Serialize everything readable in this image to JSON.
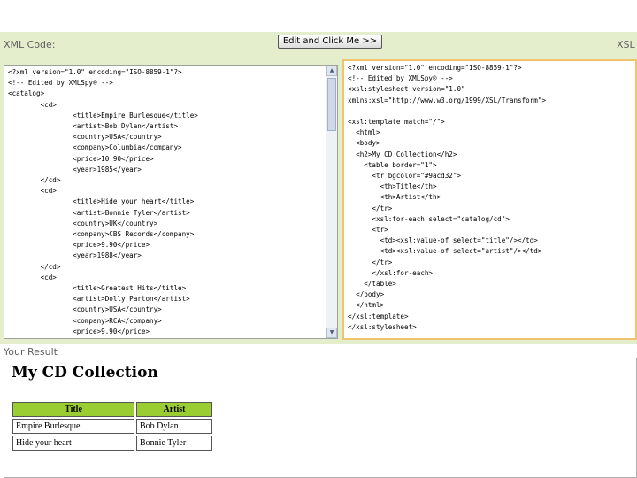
{
  "labels": {
    "xml_code": "XML Code:",
    "xsl_code": "XSL",
    "your_result": "Your Result"
  },
  "run_button": "Edit and Click Me >>",
  "xml_lines": [
    "<?xml version=\"1.0\" encoding=\"ISO-8859-1\"?>",
    "<!-- Edited by XMLSpy® -->",
    "<catalog>",
    "        <cd>",
    "                <title>Empire Burlesque</title>",
    "                <artist>Bob Dylan</artist>",
    "                <country>USA</country>",
    "                <company>Columbia</company>",
    "                <price>10.90</price>",
    "                <year>1985</year>",
    "        </cd>",
    "        <cd>",
    "                <title>Hide your heart</title>",
    "                <artist>Bonnie Tyler</artist>",
    "                <country>UK</country>",
    "                <company>CBS Records</company>",
    "                <price>9.90</price>",
    "                <year>1988</year>",
    "        </cd>",
    "        <cd>",
    "                <title>Greatest Hits</title>",
    "                <artist>Dolly Parton</artist>",
    "                <country>USA</country>",
    "                <company>RCA</company>",
    "                <price>9.90</price>"
  ],
  "xsl_lines": [
    "<?xml version=\"1.0\" encoding=\"ISO-8859-1\"?>",
    "<!-- Edited by XMLSpy® -->",
    "<xsl:stylesheet version=\"1.0\"",
    "xmlns:xsl=\"http://www.w3.org/1999/XSL/Transform\">",
    "",
    "<xsl:template match=\"/\">",
    "  <html>",
    "  <body>",
    "  <h2>My CD Collection</h2>",
    "    <table border=\"1\">",
    "      <tr bgcolor=\"#9acd32\">",
    "        <th>Title</th>",
    "        <th>Artist</th>",
    "      </tr>",
    "      <xsl:for-each select=\"catalog/cd\">",
    "      <tr>",
    "        <td><xsl:value-of select=\"title\"/></td>",
    "        <td><xsl:value-of select=\"artist\"/></td>",
    "      </tr>",
    "      </xsl:for-each>",
    "    </table>",
    "  </body>",
    "  </html>",
    "</xsl:template>",
    "</xsl:stylesheet>"
  ],
  "result": {
    "heading": "My CD Collection",
    "headers": [
      "Title",
      "Artist"
    ],
    "rows": [
      [
        "Empire Burlesque",
        "Bob Dylan"
      ],
      [
        "Hide your heart",
        "Bonnie Tyler"
      ]
    ]
  },
  "colors": {
    "band": "#e5eecc",
    "header_bg": "#9acd32",
    "xsl_border": "#f0c36d"
  }
}
